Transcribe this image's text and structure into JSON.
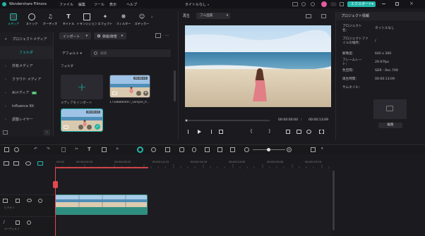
{
  "app": {
    "title": "Wondershare Filmora",
    "menu": [
      "ファイル",
      "編集",
      "ツール",
      "表示",
      "ヘルプ"
    ],
    "project_title": "タイトルなし",
    "export_label": "エクスポート"
  },
  "tools": [
    {
      "label": "メディア",
      "icon": "media-icon"
    },
    {
      "label": "ストック",
      "icon": "stock-icon"
    },
    {
      "label": "オーディオ",
      "icon": "audio-icon"
    },
    {
      "label": "タイトル",
      "icon": "title-icon"
    },
    {
      "label": "トランジション",
      "icon": "transition-icon"
    },
    {
      "label": "エフェクト",
      "icon": "effect-icon"
    },
    {
      "label": "フィルター",
      "icon": "filter-icon"
    },
    {
      "label": "ステッカー",
      "icon": "sticker-icon"
    }
  ],
  "sidebar": {
    "items": [
      {
        "label": "プロジェクトメディア",
        "selected": false
      },
      {
        "label": "フォルダ",
        "selected": true
      },
      {
        "label": "共有メディア",
        "selected": false
      },
      {
        "label": "クラウド メディア",
        "selected": false
      },
      {
        "label": "AIメディア",
        "selected": false,
        "badge": "AI"
      },
      {
        "label": "Influence Kit",
        "selected": false
      },
      {
        "label": "調整レイヤー",
        "selected": false
      }
    ]
  },
  "media": {
    "import_label": "インポート",
    "record_label": "録画/録音",
    "sort_label": "デフォルト",
    "search_placeholder": "検索",
    "folder_label": "フォルダ",
    "import_tile_label": "メディアをインポート",
    "clip1_duration": "00:00:13",
    "clip1_name": "17188880697_sample_fi...",
    "clip2_duration": "00:00:13"
  },
  "preview": {
    "tab_label": "再生",
    "quality_label": "フル品質",
    "time_current": "00:00:00:00",
    "time_separator": "/",
    "time_total": "00:00:13:09",
    "progress": 0
  },
  "project_info": {
    "header": "プロジェクト情報",
    "rows": [
      {
        "key": "プロジェクト名：",
        "value": "タイトルなし"
      },
      {
        "key": "プロジェクトファイルの場所：",
        "value": "/"
      },
      {
        "key": "解像度：",
        "value": "640 x 360"
      },
      {
        "key": "フレームレート：",
        "value": "29.97fps"
      },
      {
        "key": "色空間：",
        "value": "SDR - Rec.709"
      },
      {
        "key": "再生時間：",
        "value": "00:00:13:09"
      }
    ],
    "thumbnail_label": "サムネイル：",
    "edit_label": "編集"
  },
  "timeline": {
    "ruler_labels": [
      "00:00",
      "00:00:04:25",
      "00:00:09:20",
      "00:00:14:15",
      "00:00:19:10",
      "00:00:24:05",
      "00:00:29:00",
      "00:00:33:25"
    ],
    "video_track_label": "ビデオ 1",
    "audio_track_label": "オーディオ 1"
  },
  "colors": {
    "accent": "#23b5a8",
    "playhead": "#e2484f"
  }
}
